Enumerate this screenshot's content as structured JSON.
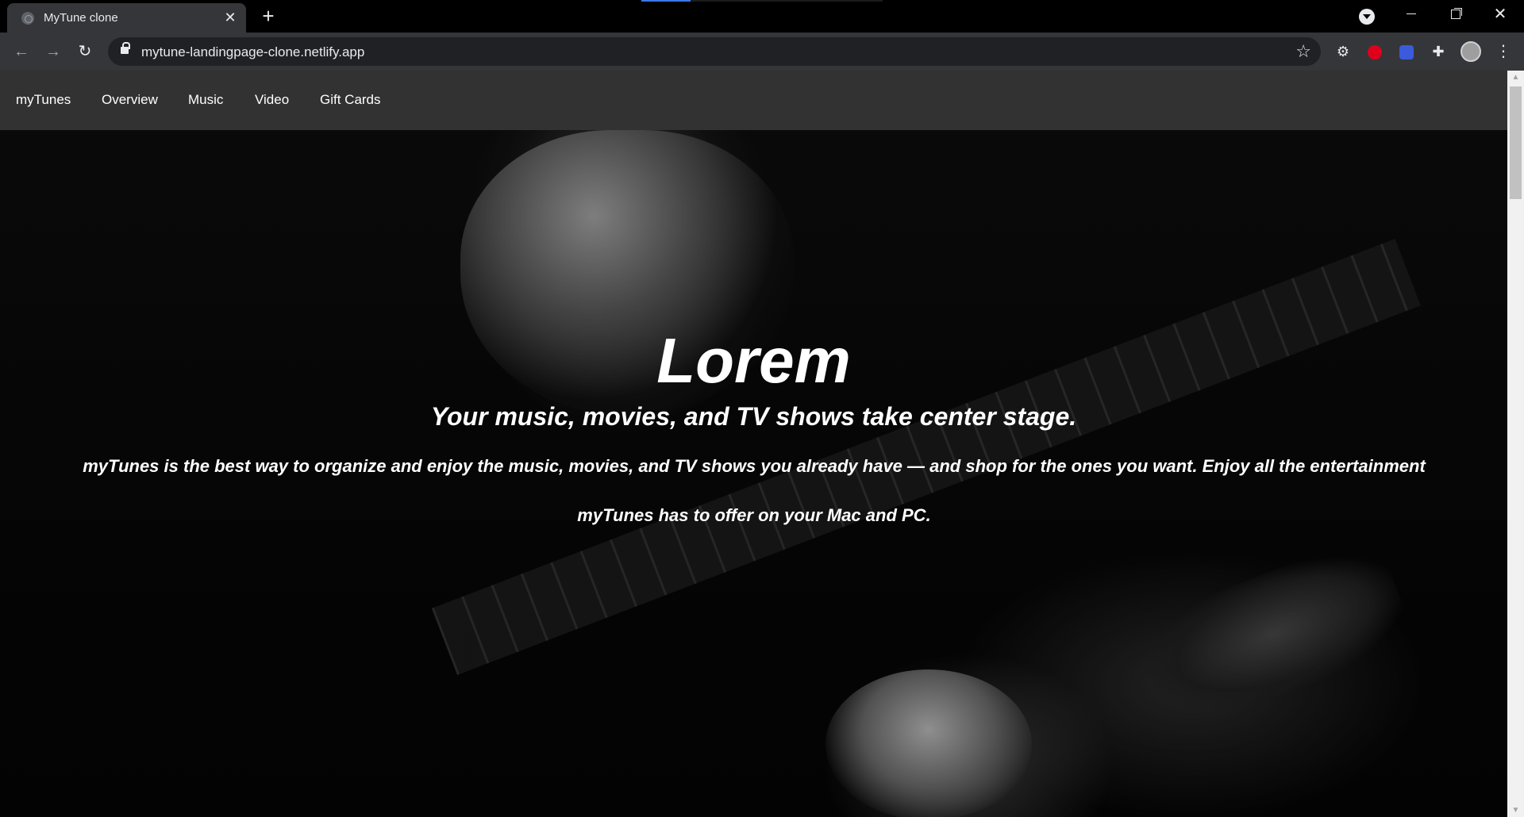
{
  "browser": {
    "tab_title": "MyTune clone",
    "tab_close": "✕",
    "new_tab": "+",
    "url": "mytune-landingpage-clone.netlify.app",
    "icons": {
      "back": "←",
      "forward": "→",
      "reload": "↻",
      "star": "☆",
      "extension_gear": "⚙",
      "extensions": "✚",
      "menu": "⋮",
      "minimize": "minimize",
      "maximize": "maximize",
      "close": "✕"
    }
  },
  "site": {
    "nav": {
      "brand": "myTunes",
      "items": [
        "Overview",
        "Music",
        "Video",
        "Gift Cards"
      ]
    },
    "hero": {
      "title": "Lorem",
      "subtitle": "Your music, movies, and TV shows take center stage.",
      "description": "myTunes is the best way to organize and enjoy the music, movies, and TV shows you already have — and shop for the ones you want. Enjoy all the entertainment myTunes has to offer on your Mac and PC."
    }
  },
  "scrollbar": {
    "up": "▲",
    "down": "▼"
  }
}
